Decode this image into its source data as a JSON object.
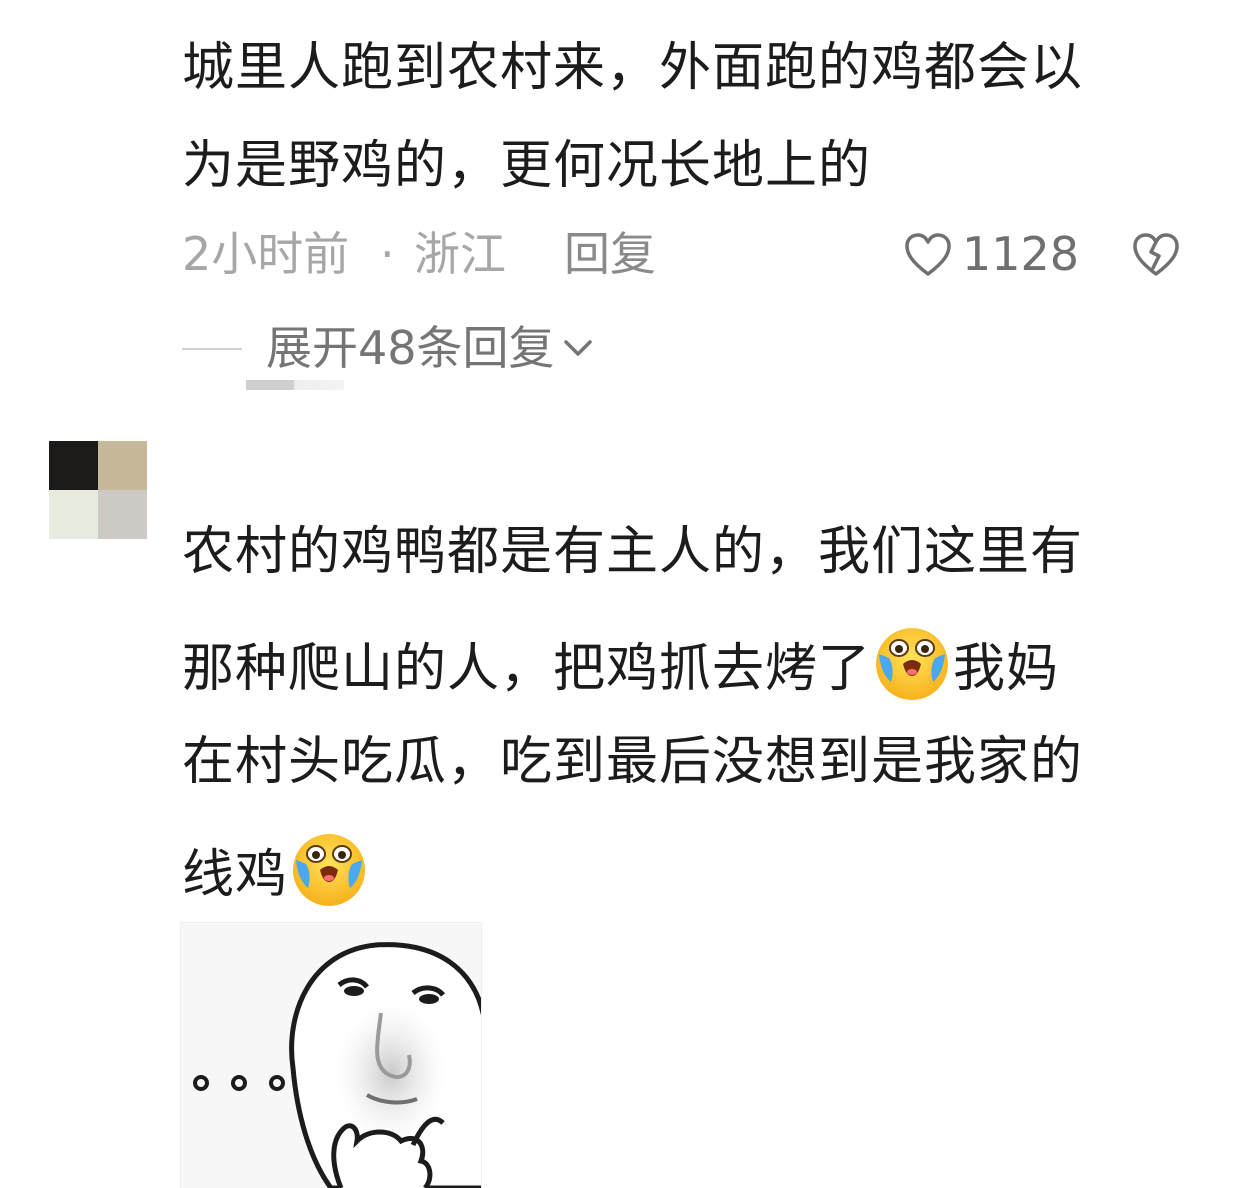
{
  "comment1": {
    "lines": [
      "城里人跑到农村来，外面跑的鸡都会以",
      "为是野鸡的，更何况长地上的"
    ],
    "time": "2小时前",
    "separator": "·",
    "location": "浙江",
    "reply_label": "回复",
    "like_count": "1128",
    "like_icon": "heart-outline-icon",
    "dislike_icon": "broken-heart-icon",
    "expand_replies_label": "展开48条回复"
  },
  "comment2": {
    "line1": "农村的鸡鸭都是有主人的，我们这里有",
    "line2_before": "那种爬山的人，把鸡抓去烤了",
    "line2_after": "我妈",
    "line3": "在村头吃瓜，吃到最后没想到是我家的",
    "line4": "线鸡",
    "emoji": "crying-laughing-emoji",
    "sticker": "thinking-meme-face-sticker"
  },
  "colors": {
    "text": "#1c1c1c",
    "meta": "#a7a7a7",
    "reply": "#8a8a8a",
    "expand": "#757575"
  }
}
